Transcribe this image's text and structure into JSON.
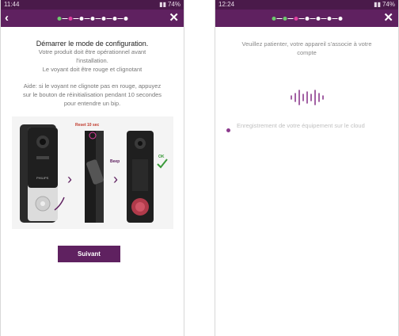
{
  "colors": {
    "brand": "#5f2160",
    "statusbar": "#4a1a4a",
    "step_done": "#6ec86e",
    "step_active": "#e040a0"
  },
  "screen1": {
    "status": {
      "time": "11:44",
      "battery": "74%"
    },
    "title": "Démarrer le mode de configuration.",
    "desc_lines": [
      "Votre produit doit être opérationnel avant",
      "l'installation.",
      "Le voyant doit être rouge et clignotant"
    ],
    "aide_lines": [
      "Aide: si le voyant ne clignote pas en rouge, appuyez",
      "sur le bouton de réinitialisation pendant 10 secondes",
      "pour entendre un bip."
    ],
    "diagram": {
      "reset_label": "Reset 10 sec",
      "beep_label": "Beep",
      "ok_label": "OK",
      "brand_label": "PHILIPS"
    },
    "button_label": "Suivant"
  },
  "screen2": {
    "status": {
      "time": "12:24",
      "battery": "74%"
    },
    "wait_lines": [
      "Veuillez patienter, votre appareil s'associe à votre",
      "compte"
    ],
    "registration_text": "Enregistrement de votre équipement sur le cloud"
  }
}
